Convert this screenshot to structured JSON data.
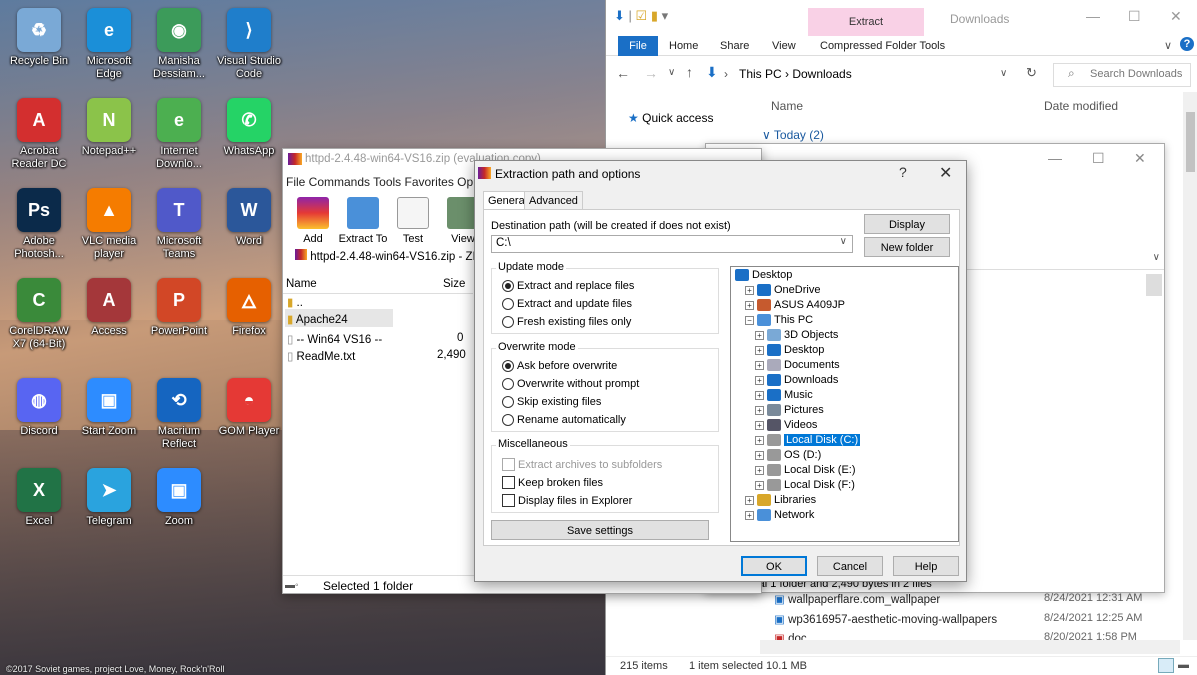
{
  "desktop": {
    "icons": [
      {
        "label": "Recycle Bin",
        "icon": "recycle-bin-icon",
        "color": "#7aa9d6"
      },
      {
        "label": "Microsoft Edge",
        "icon": "edge-icon",
        "color": "#1b8fd8"
      },
      {
        "label": "Manisha Dessiam...",
        "icon": "chrome-profile-icon",
        "color": "#3c9b5a"
      },
      {
        "label": "Visual Studio Code",
        "icon": "vscode-icon",
        "color": "#1f7ecb"
      },
      {
        "label": "Acrobat Reader DC",
        "icon": "acrobat-icon",
        "color": "#d32f2f"
      },
      {
        "label": "Notepad++",
        "icon": "notepadpp-icon",
        "color": "#8bc34a"
      },
      {
        "label": "Internet Downlo...",
        "icon": "idm-icon",
        "color": "#4caf50"
      },
      {
        "label": "WhatsApp",
        "icon": "whatsapp-icon",
        "color": "#25d366"
      },
      {
        "label": "Adobe Photosh...",
        "icon": "photoshop-icon",
        "color": "#0b2a4a"
      },
      {
        "label": "VLC media player",
        "icon": "vlc-icon",
        "color": "#f57c00"
      },
      {
        "label": "Microsoft Teams",
        "icon": "teams-icon",
        "color": "#5059c9"
      },
      {
        "label": "Word",
        "icon": "word-icon",
        "color": "#2b579a"
      },
      {
        "label": "CorelDRAW X7 (64-Bit)",
        "icon": "coreldraw-icon",
        "color": "#3a8a3a"
      },
      {
        "label": "Access",
        "icon": "access-icon",
        "color": "#a4373a"
      },
      {
        "label": "PowerPoint",
        "icon": "powerpoint-icon",
        "color": "#d24726"
      },
      {
        "label": "Firefox",
        "icon": "firefox-icon",
        "color": "#e66000"
      },
      {
        "label": "Discord",
        "icon": "discord-icon",
        "color": "#5865f2"
      },
      {
        "label": "Start Zoom",
        "icon": "zoom-icon",
        "color": "#2d8cff"
      },
      {
        "label": "Macrium Reflect",
        "icon": "macrium-icon",
        "color": "#1565c0"
      },
      {
        "label": "GOM Player",
        "icon": "gom-player-icon",
        "color": "#e53935"
      },
      {
        "label": "Excel",
        "icon": "excel-icon",
        "color": "#217346"
      },
      {
        "label": "Telegram",
        "icon": "telegram-icon",
        "color": "#2aa3de"
      },
      {
        "label": "Zoom",
        "icon": "zoom-icon",
        "color": "#2d8cff"
      }
    ],
    "credit": "©2017 Soviet games, project Love, Money, Rock'n'Roll"
  },
  "explorer": {
    "context_tab": "Extract",
    "title": "Downloads",
    "tabs": [
      "File",
      "Home",
      "Share",
      "View",
      "Compressed Folder Tools"
    ],
    "breadcrumb": "This PC  ›  Downloads",
    "search_placeholder": "Search Downloads",
    "quick_access": "Quick access",
    "col_name": "Name",
    "col_date": "Date modified",
    "group_today": "Today (2)",
    "summary": "Total 1 folder and 2,490 bytes in 2 files",
    "rows": [
      {
        "name": "wallpaperflare.com_wallpaper",
        "date": "8/24/2021 12:31 AM"
      },
      {
        "name": "wp3616957-aesthetic-moving-wallpapers",
        "date": "8/24/2021 12:25 AM"
      },
      {
        "name": "doc",
        "date": "8/20/2021 1:58 PM"
      }
    ],
    "status_items": "215 items",
    "status_selected": "1 item selected  10.1 MB"
  },
  "winrar": {
    "title": "httpd-2.4.48-win64-VS16.zip (evaluation copy)",
    "menu": "File  Commands  Tools  Favorites  Op",
    "tools": [
      "Add",
      "Extract To",
      "Test",
      "View"
    ],
    "path": "httpd-2.4.48-win64-VS16.zip - ZI",
    "col_name": "Name",
    "col_size": "Size",
    "items": [
      {
        "name": "..",
        "size": ""
      },
      {
        "name": "Apache24",
        "size": ""
      },
      {
        "name": "-- Win64 VS16 --",
        "size": "0"
      },
      {
        "name": "ReadMe.txt",
        "size": "2,490"
      }
    ],
    "status": "Selected 1 folder"
  },
  "dialog": {
    "title": "Extraction path and options",
    "help": "?",
    "close": "✕",
    "tab_general": "General",
    "tab_advanced": "Advanced",
    "dest_label": "Destination path (will be created if does not exist)",
    "dest_value": "C:\\",
    "display_btn": "Display",
    "newfolder_btn": "New folder",
    "update_mode": {
      "title": "Update mode",
      "options": [
        "Extract and replace files",
        "Extract and update files",
        "Fresh existing files only"
      ],
      "selected": 0
    },
    "overwrite_mode": {
      "title": "Overwrite mode",
      "options": [
        "Ask before overwrite",
        "Overwrite without prompt",
        "Skip existing files",
        "Rename automatically"
      ],
      "selected": 0
    },
    "misc": {
      "title": "Miscellaneous",
      "options": [
        "Extract archives to subfolders",
        "Keep broken files",
        "Display files in Explorer"
      ]
    },
    "save_btn": "Save settings",
    "tree": [
      {
        "label": "Desktop",
        "icon": "desktop-folder-icon"
      },
      {
        "label": "OneDrive",
        "icon": "onedrive-icon"
      },
      {
        "label": "ASUS A409JP",
        "icon": "user-icon"
      },
      {
        "label": "This PC",
        "icon": "computer-icon"
      },
      {
        "label": "3D Objects",
        "icon": "3d-objects-icon"
      },
      {
        "label": "Desktop",
        "icon": "desktop-folder-icon"
      },
      {
        "label": "Documents",
        "icon": "documents-icon"
      },
      {
        "label": "Downloads",
        "icon": "downloads-icon"
      },
      {
        "label": "Music",
        "icon": "music-icon"
      },
      {
        "label": "Pictures",
        "icon": "pictures-icon"
      },
      {
        "label": "Videos",
        "icon": "videos-icon"
      },
      {
        "label": "Local Disk (C:)",
        "icon": "drive-icon"
      },
      {
        "label": "OS (D:)",
        "icon": "drive-icon"
      },
      {
        "label": "Local Disk (E:)",
        "icon": "drive-icon"
      },
      {
        "label": "Local Disk (F:)",
        "icon": "drive-icon"
      },
      {
        "label": "Libraries",
        "icon": "libraries-icon"
      },
      {
        "label": "Network",
        "icon": "network-icon"
      }
    ],
    "ok_btn": "OK",
    "cancel_btn": "Cancel",
    "help_btn": "Help",
    "accent": "#0078d7"
  }
}
